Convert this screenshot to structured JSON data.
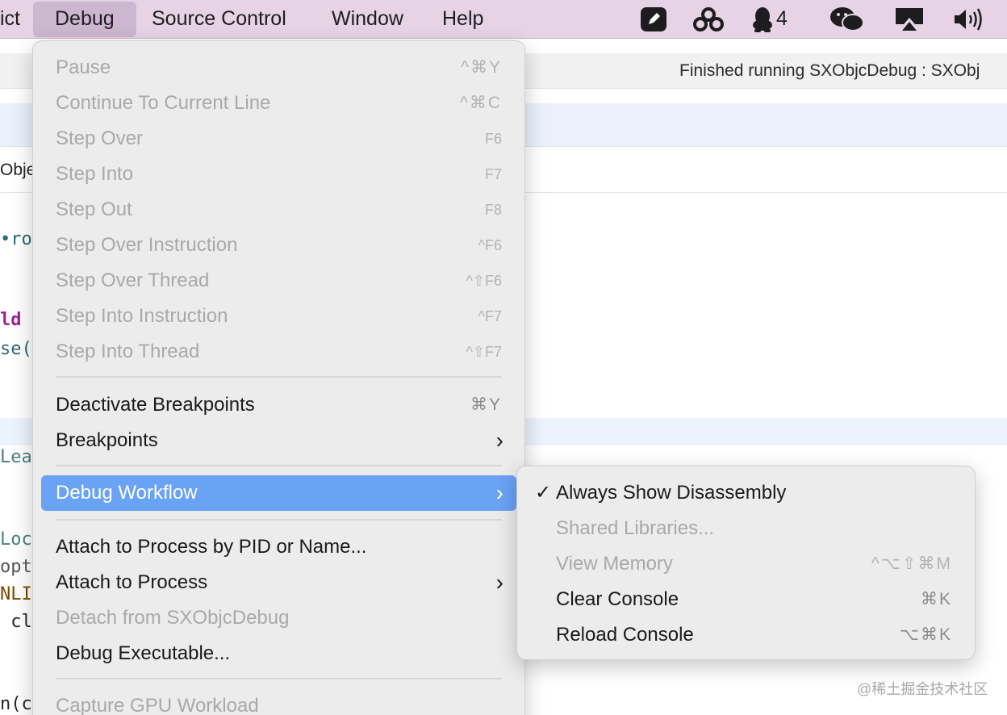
{
  "menubar": {
    "items": [
      "ict",
      "Debug",
      "Source Control",
      "Window",
      "Help"
    ],
    "qq_count": "4"
  },
  "toolbar": {
    "status": "Finished running SXObjcDebug : SXObj"
  },
  "jump_bar": {
    "text": "Obje"
  },
  "code_fragments": [
    "•roc",
    "ld",
    "se(:",
    "Leas",
    "Loc",
    "opt",
    "NLIN",
    " cls",
    "n(cl"
  ],
  "debug_menu": {
    "items": [
      {
        "label": "Pause",
        "shortcut": "^⌘Y",
        "enabled": false
      },
      {
        "label": "Continue To Current Line",
        "shortcut": "^⌘C",
        "enabled": false
      },
      {
        "label": "Step Over",
        "shortcut": "F6",
        "enabled": false
      },
      {
        "label": "Step Into",
        "shortcut": "F7",
        "enabled": false
      },
      {
        "label": "Step Out",
        "shortcut": "F8",
        "enabled": false
      },
      {
        "label": "Step Over Instruction",
        "shortcut": "^F6",
        "enabled": false
      },
      {
        "label": "Step Over Thread",
        "shortcut": "^⇧F6",
        "enabled": false
      },
      {
        "label": "Step Into Instruction",
        "shortcut": "^F7",
        "enabled": false
      },
      {
        "label": "Step Into Thread",
        "shortcut": "^⇧F7",
        "enabled": false
      },
      {
        "label": "Deactivate Breakpoints",
        "shortcut": "⌘Y",
        "enabled": true
      },
      {
        "label": "Breakpoints",
        "submenu": true,
        "enabled": true
      },
      {
        "label": "Debug Workflow",
        "submenu": true,
        "enabled": true,
        "selected": true
      },
      {
        "label": "Attach to Process by PID or Name...",
        "enabled": true
      },
      {
        "label": "Attach to Process",
        "submenu": true,
        "enabled": true
      },
      {
        "label": "Detach from SXObjcDebug",
        "enabled": false
      },
      {
        "label": "Debug Executable...",
        "enabled": true
      },
      {
        "label": "Capture GPU Workload",
        "enabled": false
      }
    ]
  },
  "workflow_menu": {
    "items": [
      {
        "label": "Always Show Disassembly",
        "checked": true,
        "enabled": true
      },
      {
        "label": "Shared Libraries...",
        "enabled": false
      },
      {
        "label": "View Memory",
        "shortcut": "^⌥⇧⌘M",
        "enabled": false
      },
      {
        "label": "Clear Console",
        "shortcut": "⌘K",
        "enabled": true
      },
      {
        "label": "Reload Console",
        "shortcut": "⌥⌘K",
        "enabled": true
      }
    ],
    "check_glyph": "✓"
  },
  "submenu_glyph": "›",
  "watermark": "@稀土掘金技术社区",
  "colors": {
    "menubar_bg": "#e6d3e6",
    "menu_bg": "#ececec",
    "selected_bg": "#6aa2f5",
    "disabled_text": "#a9a9a9"
  }
}
